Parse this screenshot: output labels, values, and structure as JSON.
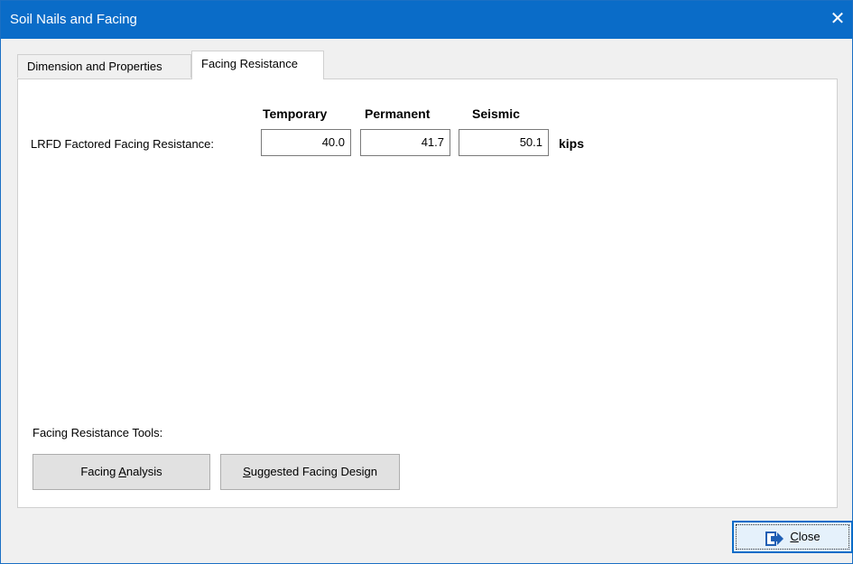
{
  "window": {
    "title": "Soil Nails and Facing",
    "close_glyph": "✕"
  },
  "tabs": [
    {
      "label": "Dimension and Properties",
      "active": false
    },
    {
      "label": "Facing Resistance",
      "active": true
    }
  ],
  "resistance": {
    "headers": [
      "Temporary",
      "Permanent",
      "Seismic"
    ],
    "row_label": "LRFD Factored Facing Resistance:",
    "values": [
      "40.0",
      "41.7",
      "50.1"
    ],
    "units": "kips"
  },
  "tools": {
    "label": "Facing Resistance Tools:",
    "analysis_pre": "Facing ",
    "analysis_mnemonic": "A",
    "analysis_post": "nalysis",
    "design_mnemonic": "S",
    "design_post": "uggested Facing Design"
  },
  "close_button": {
    "mnemonic": "C",
    "post": "lose",
    "icon": "exit-icon"
  },
  "colors": {
    "titlebar": "#0a6cc8",
    "icon_blue": "#1f5fb4"
  }
}
